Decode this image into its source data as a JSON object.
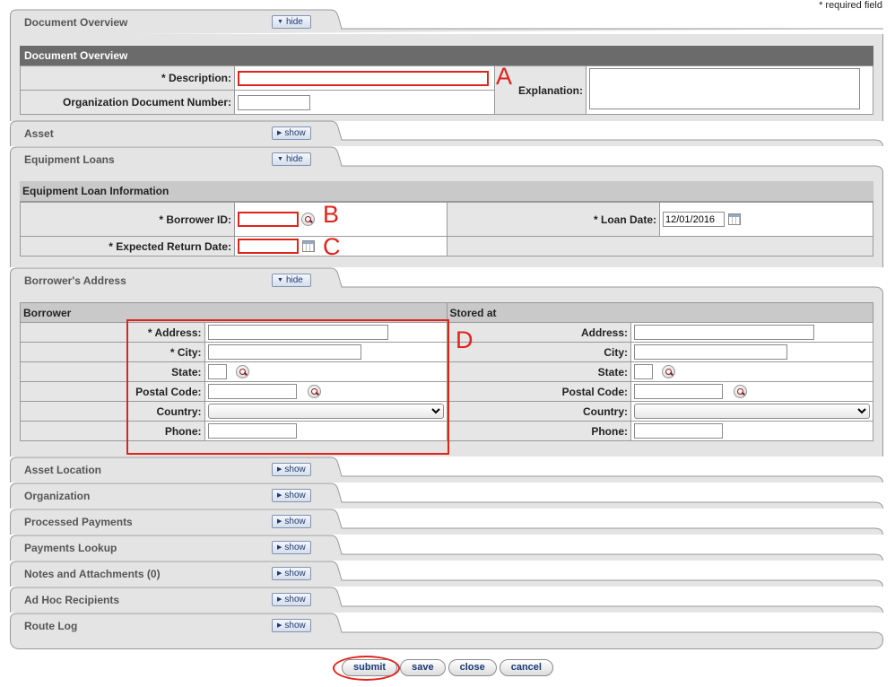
{
  "required_note": "* required field",
  "doc_overview": {
    "tab_title": "Document Overview",
    "toggle": "hide",
    "section_title": "Document Overview",
    "description_label": "* Description:",
    "org_doc_number_label": "Organization Document Number:",
    "explanation_label": "Explanation:"
  },
  "asset_tab": {
    "title": "Asset",
    "toggle": "show"
  },
  "equipment_loans": {
    "tab_title": "Equipment Loans",
    "toggle": "hide",
    "section_title": "Equipment Loan Information",
    "borrower_id_label": "* Borrower ID:",
    "loan_date_label": "* Loan Date:",
    "loan_date_value": "12/01/2016",
    "expected_return_label": "* Expected Return Date:"
  },
  "borrower_address": {
    "tab_title": "Borrower's Address",
    "toggle": "hide",
    "borrower_header": "Borrower",
    "stored_header": "Stored at",
    "borrower": {
      "address_label": "* Address:",
      "city_label": "* City:",
      "state_label": "State:",
      "postal_label": "Postal Code:",
      "country_label": "Country:",
      "phone_label": "Phone:"
    },
    "stored": {
      "address_label": "Address:",
      "city_label": "City:",
      "state_label": "State:",
      "postal_label": "Postal Code:",
      "country_label": "Country:",
      "phone_label": "Phone:"
    }
  },
  "collapsed_tabs": [
    {
      "title": "Asset Location",
      "toggle": "show"
    },
    {
      "title": "Organization",
      "toggle": "show"
    },
    {
      "title": "Processed Payments",
      "toggle": "show"
    },
    {
      "title": "Payments Lookup",
      "toggle": "show"
    },
    {
      "title": "Notes and Attachments (0)",
      "toggle": "show"
    },
    {
      "title": "Ad Hoc Recipients",
      "toggle": "show"
    },
    {
      "title": "Route Log",
      "toggle": "show"
    }
  ],
  "markers": {
    "a": "A",
    "b": "B",
    "c": "C",
    "d": "D"
  },
  "buttons": {
    "submit": "submit",
    "save": "save",
    "close": "close",
    "cancel": "cancel"
  },
  "colors": {
    "highlight": "#e0231b",
    "section_dark": "#6b6b6b",
    "button_text": "#1b3a78"
  }
}
